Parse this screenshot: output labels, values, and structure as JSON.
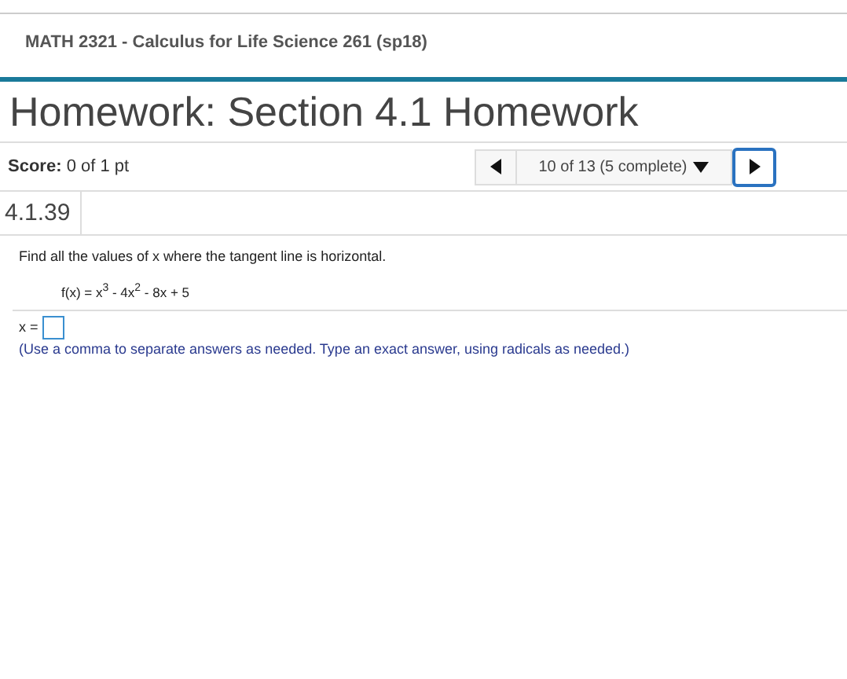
{
  "course": "MATH 2321 - Calculus for Life Science 261 (sp18)",
  "title": "Homework: Section 4.1 Homework",
  "score": {
    "label": "Score:",
    "value": "0 of 1 pt"
  },
  "nav": {
    "position": "10 of 13 (5 complete)"
  },
  "problem_number": "4.1.39",
  "question": "Find all the values of x where the tangent line is horizontal.",
  "function": "f(x) = x$^{3}$ - 4x$^{2}$ - 8x + 5",
  "answer": {
    "label": "x ="
  },
  "hint": "(Use a comma to separate answers as needed. Type an exact answer, using radicals as needed.)"
}
